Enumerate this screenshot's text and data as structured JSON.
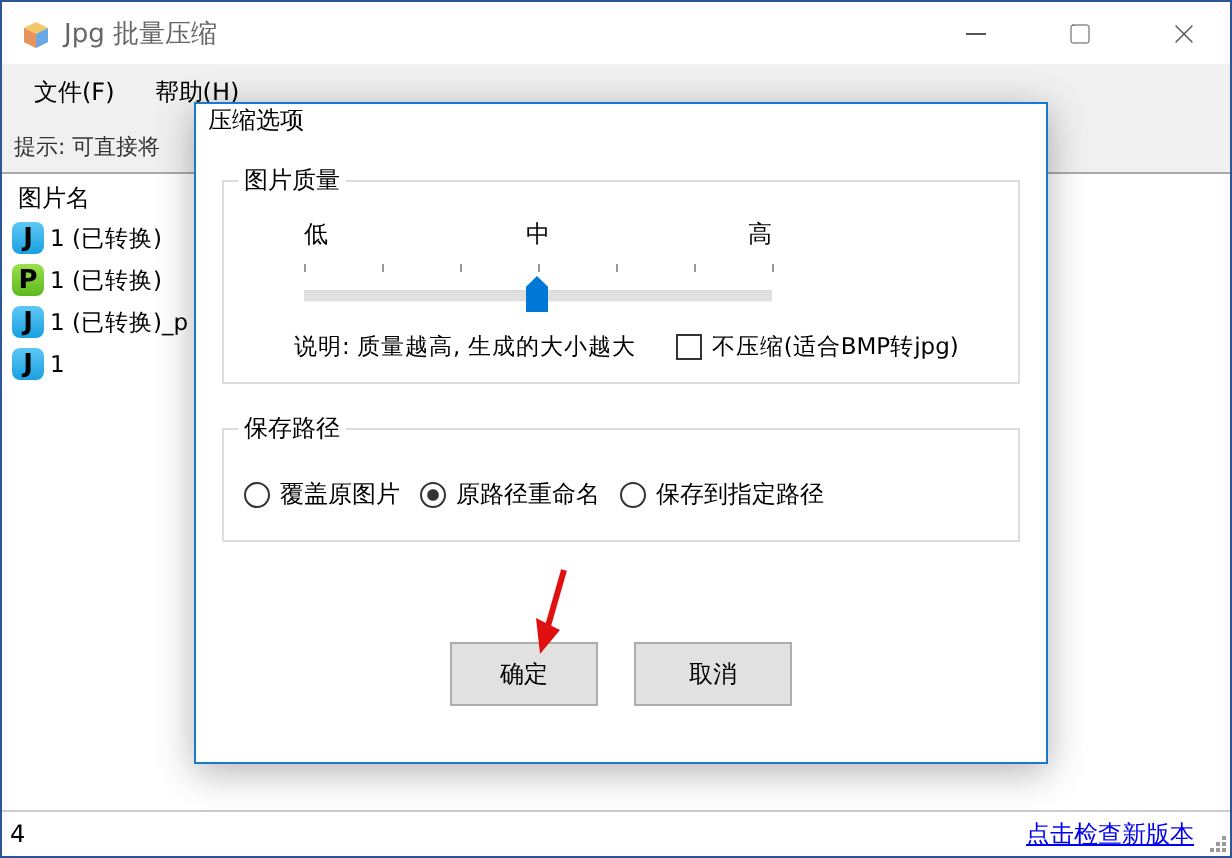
{
  "window": {
    "title": "Jpg 批量压缩"
  },
  "menu": [
    {
      "label": "文件(F)"
    },
    {
      "label": "帮助(H)"
    }
  ],
  "hint": "提示: 可直接将",
  "list": {
    "header": "图片名",
    "items": [
      {
        "kind": "jpg",
        "badge": "J",
        "name": "1 (已转换)"
      },
      {
        "kind": "png",
        "badge": "P",
        "name": "1 (已转换)"
      },
      {
        "kind": "jpg",
        "badge": "J",
        "name": "1 (已转换)_p"
      },
      {
        "kind": "jpg",
        "badge": "J",
        "name": "1"
      }
    ]
  },
  "dialog": {
    "title": "压缩选项",
    "quality": {
      "title": "图片质量",
      "labels": [
        "低",
        "中",
        "高"
      ],
      "level": 0.5,
      "note": "说明: 质量越高, 生成的大小越大",
      "no_compress": {
        "label": "不压缩(适合BMP转jpg)",
        "checked": false
      }
    },
    "save_path": {
      "title": "保存路径",
      "options": [
        {
          "label": "覆盖原图片",
          "selected": false
        },
        {
          "label": "原路径重命名",
          "selected": true
        },
        {
          "label": "保存到指定路径",
          "selected": false
        }
      ]
    },
    "buttons": [
      "确定",
      "取消"
    ]
  },
  "status_bar": {
    "count": "4",
    "link": "点击检查新版本"
  }
}
